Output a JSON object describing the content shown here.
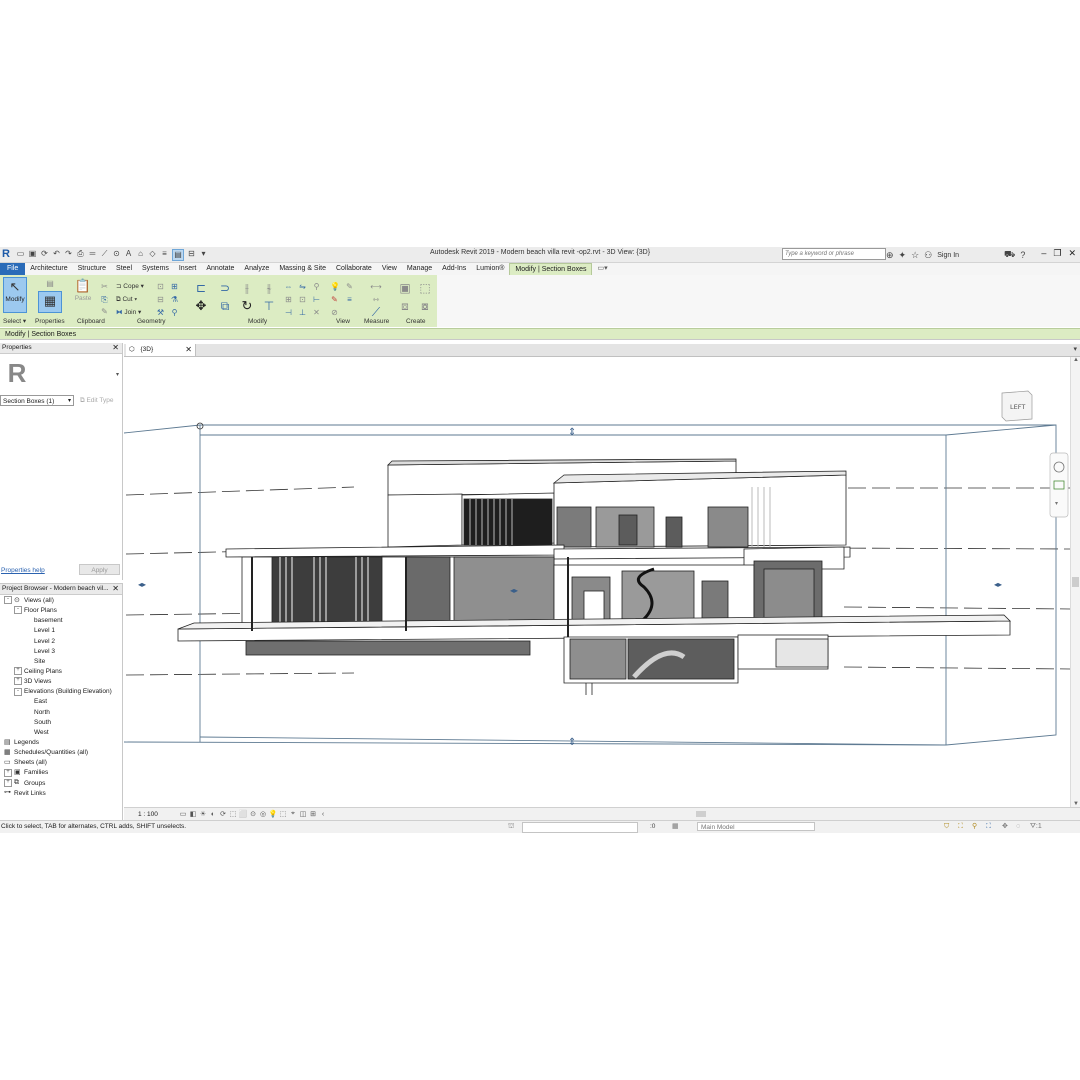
{
  "window": {
    "title": "Autodesk Revit 2019 - Modern beach villa revit -op2.rvt - 3D View: {3D}",
    "search_placeholder": "Type a keyword or phrase",
    "sign_in": "Sign In"
  },
  "tabs": [
    "File",
    "Architecture",
    "Structure",
    "Steel",
    "Systems",
    "Insert",
    "Annotate",
    "Analyze",
    "Massing & Site",
    "Collaborate",
    "View",
    "Manage",
    "Add-Ins",
    "Lumion®",
    "Modify | Section Boxes"
  ],
  "ribbon": {
    "modify_label": "Modify",
    "select_label": "Select",
    "properties_label": "Properties",
    "paste_label": "Paste",
    "cope_label": "Cope",
    "cut_label": "Cut",
    "join_label": "Join",
    "panels": {
      "clipboard": "Clipboard",
      "geometry": "Geometry",
      "modify": "Modify",
      "view": "View",
      "measure": "Measure",
      "create": "Create"
    }
  },
  "context_bar": "Modify | Section Boxes",
  "properties": {
    "title": "Properties",
    "type_selector": "Section Boxes (1)",
    "edit_type": "Edit Type",
    "help_link": "Properties help",
    "apply_button": "Apply"
  },
  "project_browser": {
    "title": "Project Browser - Modern beach vil...",
    "tree": [
      {
        "label": "Views (all)",
        "level": 0,
        "toggle": "-",
        "icon": "views"
      },
      {
        "label": "Floor Plans",
        "level": 1,
        "toggle": "-"
      },
      {
        "label": "basement",
        "level": 2
      },
      {
        "label": "Level 1",
        "level": 2
      },
      {
        "label": "Level 2",
        "level": 2
      },
      {
        "label": "Level 3",
        "level": 2
      },
      {
        "label": "Site",
        "level": 2
      },
      {
        "label": "Ceiling Plans",
        "level": 1,
        "toggle": "+"
      },
      {
        "label": "3D Views",
        "level": 1,
        "toggle": "+"
      },
      {
        "label": "Elevations (Building Elevation)",
        "level": 1,
        "toggle": "-"
      },
      {
        "label": "East",
        "level": 2
      },
      {
        "label": "North",
        "level": 2
      },
      {
        "label": "South",
        "level": 2
      },
      {
        "label": "West",
        "level": 2
      },
      {
        "label": "Legends",
        "level": 0,
        "icon": "legend"
      },
      {
        "label": "Schedules/Quantities (all)",
        "level": 0,
        "icon": "schedule"
      },
      {
        "label": "Sheets (all)",
        "level": 0,
        "icon": "sheet"
      },
      {
        "label": "Families",
        "level": 0,
        "toggle": "+",
        "icon": "family"
      },
      {
        "label": "Groups",
        "level": 0,
        "toggle": "+",
        "icon": "group"
      },
      {
        "label": "Revit Links",
        "level": 0,
        "icon": "link"
      }
    ]
  },
  "view_tab": {
    "label": "{3D}"
  },
  "viewcube": {
    "face": "LEFT"
  },
  "view_control": {
    "scale": "1 : 100"
  },
  "status": {
    "message": "Click to select, TAB for alternates, CTRL adds, SHIFT unselects.",
    "zero": ":0",
    "model": "Main Model"
  }
}
